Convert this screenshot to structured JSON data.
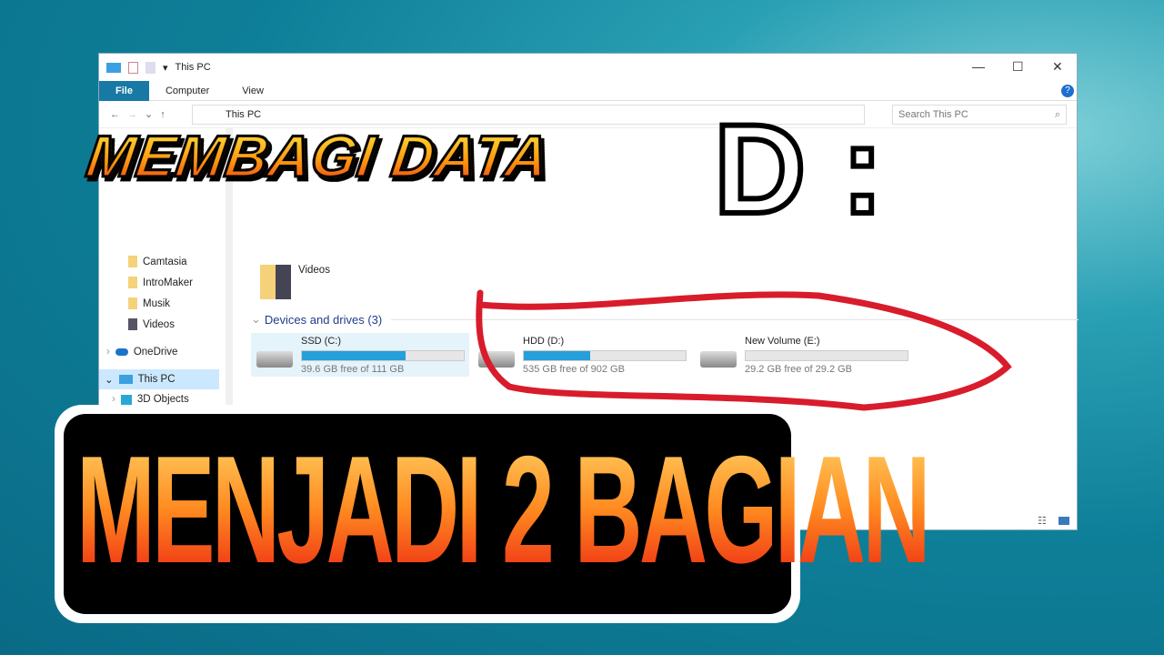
{
  "window": {
    "title": "This PC",
    "controls": [
      "—",
      "☐",
      "✕"
    ],
    "ribbon_tabs": [
      "File",
      "Computer",
      "View"
    ],
    "address": "This PC",
    "search_placeholder": "Search This PC"
  },
  "nav": {
    "items": [
      {
        "label": "Camtasia"
      },
      {
        "label": "IntroMaker"
      },
      {
        "label": "Musik"
      },
      {
        "label": "Videos"
      },
      {
        "label": "OneDrive"
      },
      {
        "label": "This PC"
      },
      {
        "label": "3D Objects"
      }
    ]
  },
  "main": {
    "folder": "Videos",
    "group": "Devices and drives (3)",
    "drives": [
      {
        "name": "SSD (C:)",
        "info": "39.6 GB free of 111 GB",
        "used_fraction": 0.64
      },
      {
        "name": "HDD (D:)",
        "info": "535 GB free of 902 GB",
        "used_fraction": 0.41
      },
      {
        "name": "New Volume (E:)",
        "info": "29.2 GB free of 29.2 GB",
        "used_fraction": 0.0
      }
    ]
  },
  "overlay": {
    "line1": "MEMBAGI DATA",
    "line2": "D :",
    "line3": "MENJADI 2 BAGIAN",
    "annotation_color": "#d81c2c"
  }
}
